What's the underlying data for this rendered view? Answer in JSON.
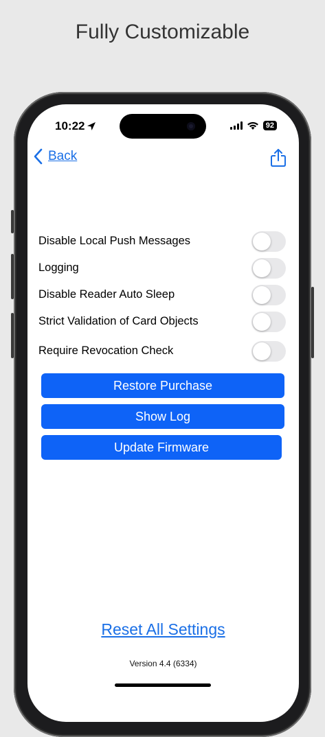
{
  "headline": "Fully Customizable",
  "status_bar": {
    "time": "10:22",
    "battery": "92"
  },
  "nav": {
    "back_label": "Back"
  },
  "settings": [
    {
      "label": "Disable Local Push Messages",
      "enabled": false
    },
    {
      "label": "Logging",
      "enabled": false
    },
    {
      "label": "Disable Reader Auto Sleep",
      "enabled": false
    },
    {
      "label": "Strict Validation of Card Objects",
      "enabled": false
    },
    {
      "label": "Require Revocation Check",
      "enabled": false
    }
  ],
  "actions": {
    "restore_label": "Restore Purchase",
    "show_log_label": "Show Log",
    "update_label": "Update Firmware"
  },
  "reset_label": "Reset All Settings",
  "version": "Version 4.4 (6334)",
  "colors": {
    "accent": "#0e63f7",
    "link": "#1a6fe6",
    "toggle_off": "#e8e8ea"
  },
  "icons": {
    "back": "chevron-left-icon",
    "share": "share-icon",
    "location": "location-arrow-icon"
  }
}
